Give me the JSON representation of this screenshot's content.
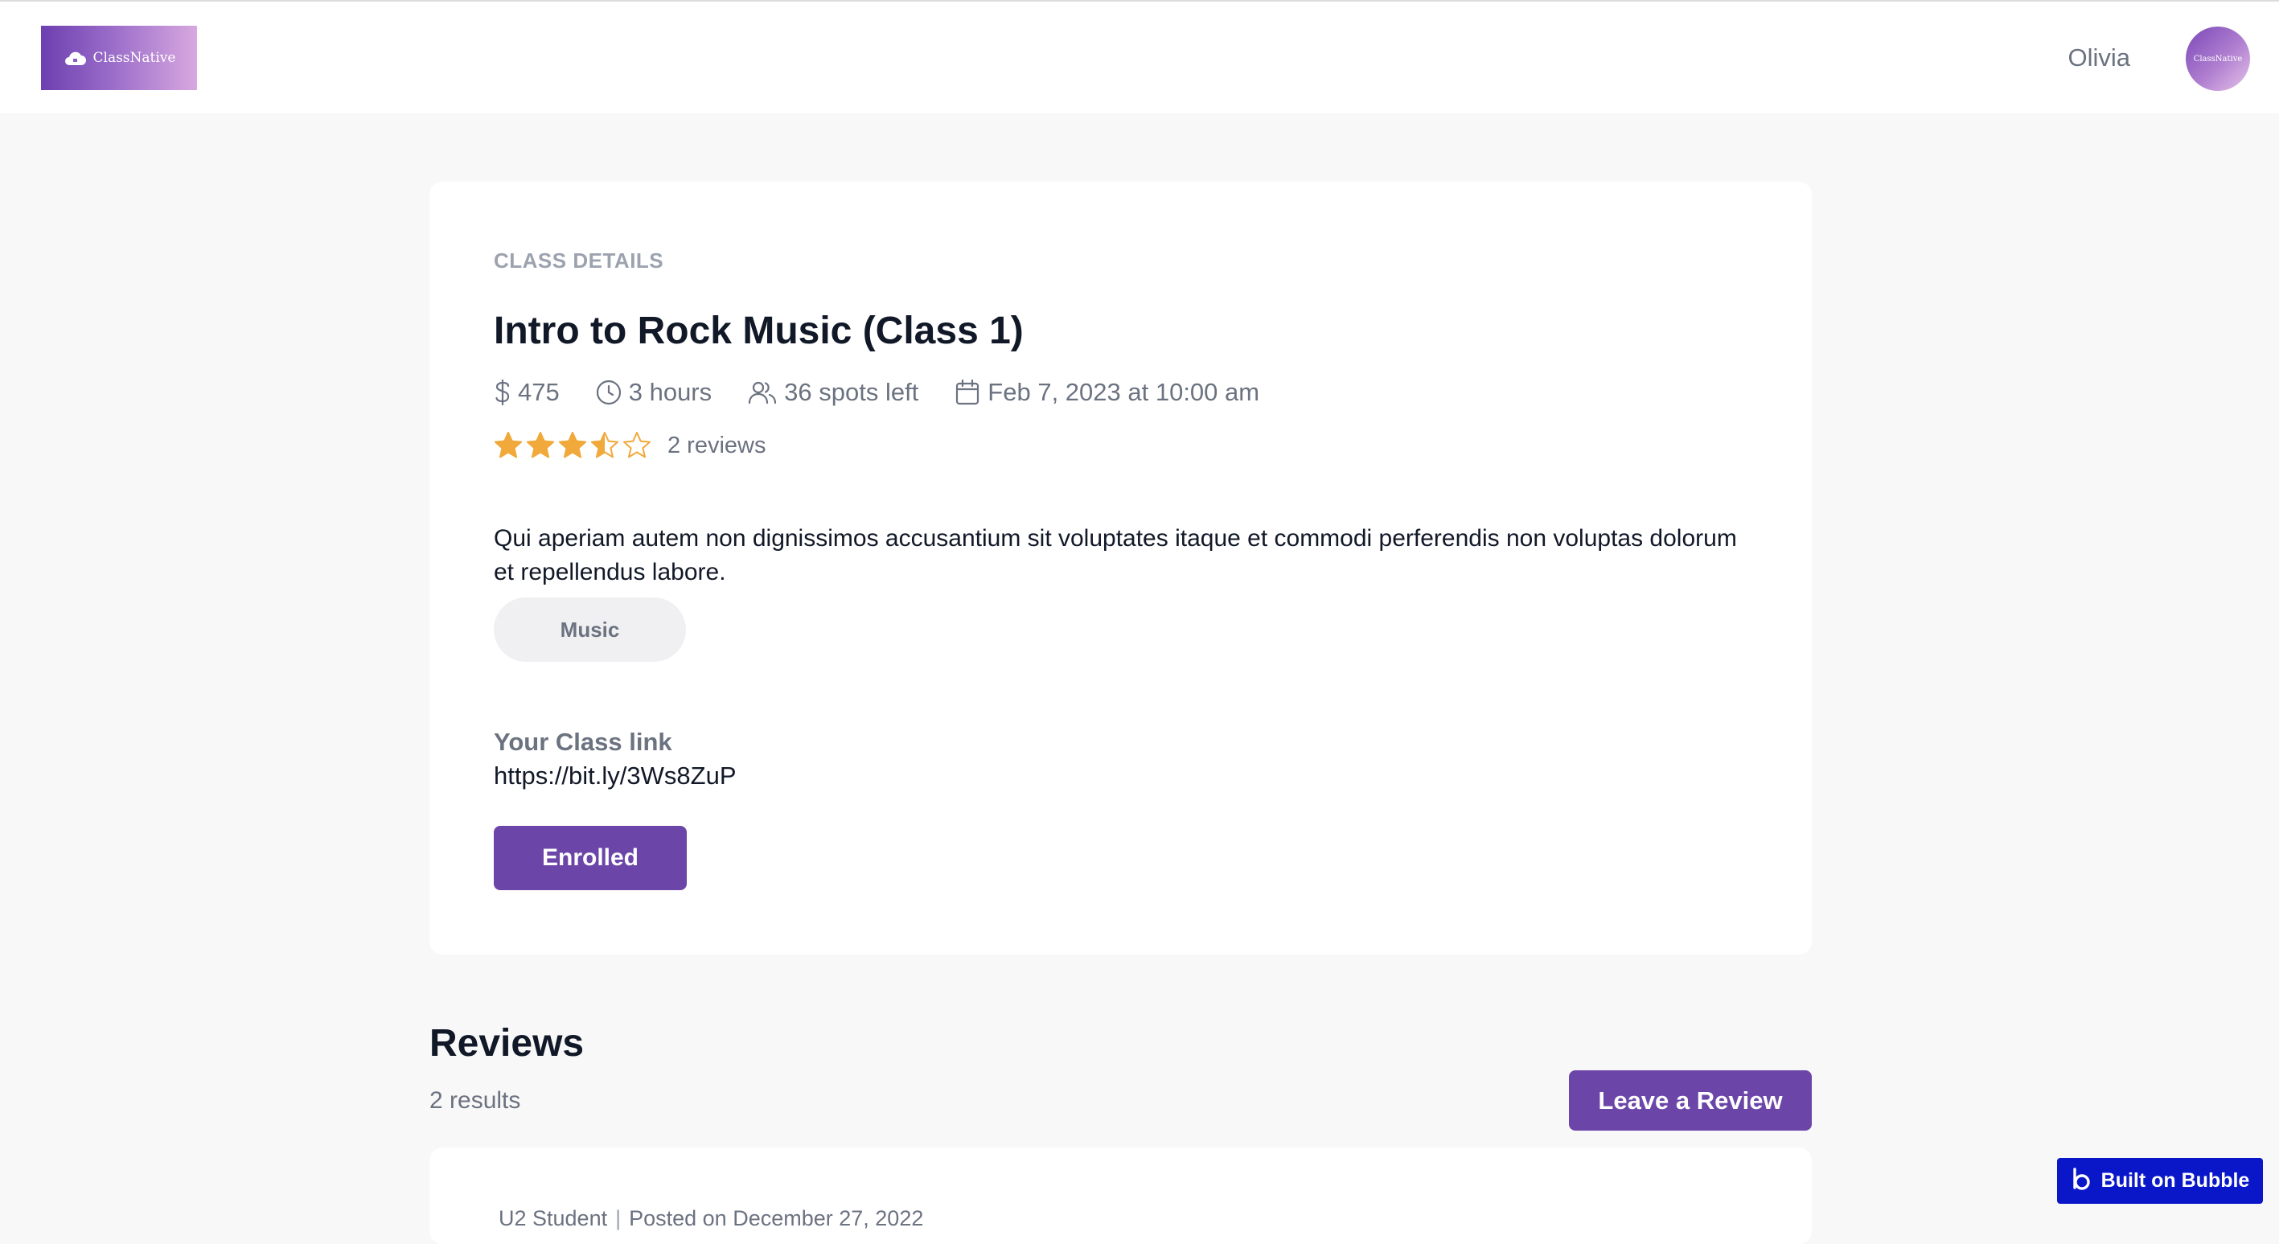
{
  "header": {
    "logo_text": "ClassNative",
    "user_name": "Olivia",
    "avatar_text": "ClassNative"
  },
  "class": {
    "eyebrow": "CLASS DETAILS",
    "title": "Intro to Rock Music (Class 1)",
    "price": "475",
    "duration": "3 hours",
    "spots": "36 spots left",
    "date": "Feb 7, 2023 at 10:00 am",
    "rating": 3.5,
    "rating_max": 5,
    "reviews_count": "2 reviews",
    "description": "Qui aperiam autem non dignissimos accusantium sit voluptates itaque et commodi perferendis non voluptas dolorum et repellendus labore.",
    "tag": "Music",
    "link_label": "Your Class link",
    "link_value": "https://bit.ly/3Ws8ZuP",
    "enrolled_label": "Enrolled"
  },
  "reviews": {
    "title": "Reviews",
    "results": "2 results",
    "leave_review_label": "Leave a Review",
    "first_review": {
      "author": "U2 Student",
      "posted": "Posted on December 27, 2022"
    }
  },
  "badge": {
    "label": "Built on Bubble"
  },
  "colors": {
    "accent": "#6b46a8",
    "star": "#f0a93a",
    "badge": "#0a17c9",
    "muted_text": "#6b7280",
    "background": "#f8f8f8"
  }
}
